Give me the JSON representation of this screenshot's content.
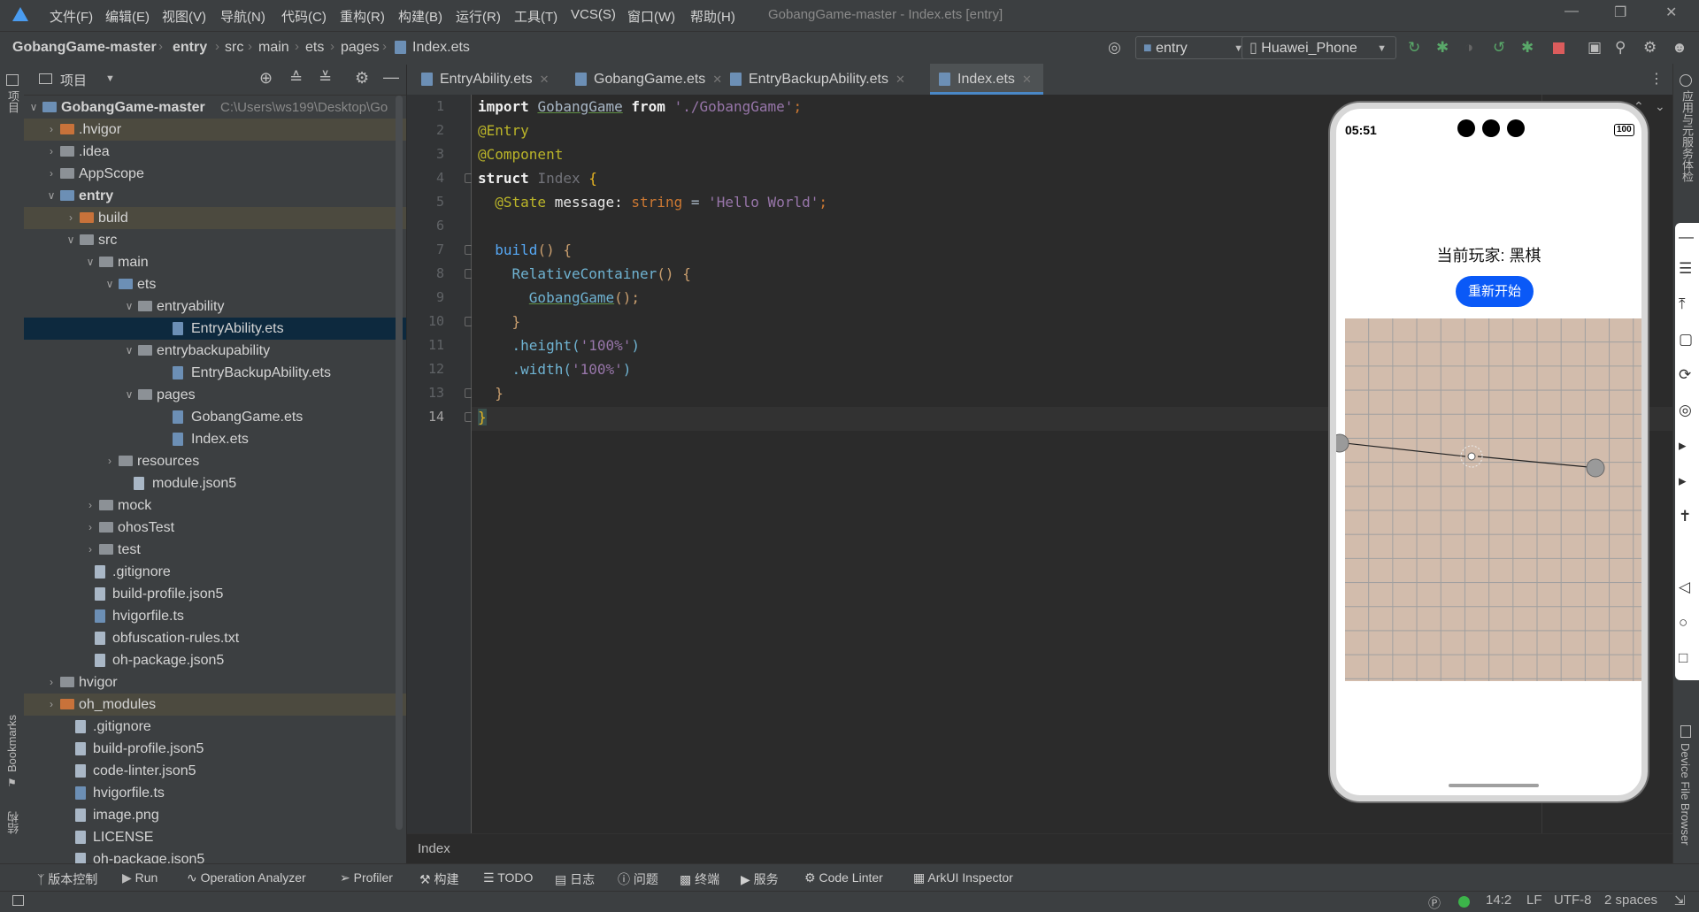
{
  "menubar": {
    "items": [
      "文件(F)",
      "编辑(E)",
      "视图(V)",
      "导航(N)",
      "代码(C)",
      "重构(R)",
      "构建(B)",
      "运行(R)",
      "工具(T)",
      "VCS(S)",
      "窗口(W)",
      "帮助(H)"
    ],
    "window_title": "GobangGame-master - Index.ets [entry]"
  },
  "navbar": {
    "breadcrumb": [
      "GobangGame-master",
      "entry",
      "src",
      "main",
      "ets",
      "pages",
      "Index.ets"
    ],
    "run_config": "entry",
    "device": "Huawei_Phone"
  },
  "left_strip": {
    "project_label": "项目",
    "bookmarks_label": "Bookmarks",
    "structure_label": "结构"
  },
  "project_panel": {
    "title": "项目",
    "rows": [
      {
        "label": "GobangGame-master",
        "path": "C:\\Users\\ws199\\Desktop\\Go"
      },
      {
        "label": ".hvigor"
      },
      {
        "label": ".idea"
      },
      {
        "label": "AppScope"
      },
      {
        "label": "entry"
      },
      {
        "label": "build"
      },
      {
        "label": "src"
      },
      {
        "label": "main"
      },
      {
        "label": "ets"
      },
      {
        "label": "entryability"
      },
      {
        "label": "EntryAbility.ets"
      },
      {
        "label": "entrybackupability"
      },
      {
        "label": "EntryBackupAbility.ets"
      },
      {
        "label": "pages"
      },
      {
        "label": "GobangGame.ets"
      },
      {
        "label": "Index.ets"
      },
      {
        "label": "resources"
      },
      {
        "label": "module.json5"
      },
      {
        "label": "mock"
      },
      {
        "label": "ohosTest"
      },
      {
        "label": "test"
      },
      {
        "label": ".gitignore"
      },
      {
        "label": "build-profile.json5"
      },
      {
        "label": "hvigorfile.ts"
      },
      {
        "label": "obfuscation-rules.txt"
      },
      {
        "label": "oh-package.json5"
      },
      {
        "label": "hvigor"
      },
      {
        "label": "oh_modules"
      },
      {
        "label": ".gitignore"
      },
      {
        "label": "build-profile.json5"
      },
      {
        "label": "code-linter.json5"
      },
      {
        "label": "hvigorfile.ts"
      },
      {
        "label": "image.png"
      },
      {
        "label": "LICENSE"
      },
      {
        "label": "oh-package.json5"
      }
    ]
  },
  "tabs": [
    "EntryAbility.ets",
    "GobangGame.ets",
    "EntryBackupAbility.ets",
    "Index.ets"
  ],
  "editor": {
    "line_numbers": [
      "1",
      "2",
      "3",
      "4",
      "5",
      "6",
      "7",
      "8",
      "9",
      "10",
      "11",
      "12",
      "13",
      "14"
    ],
    "code": {
      "l1_import": "import",
      "l1_name": "GobangGame",
      "l1_from": "from",
      "l1_path": "'./GobangGame'",
      "l1_semi": ";",
      "l2": "@Entry",
      "l3": "@Component",
      "l4_struct": "struct",
      "l4_name": "Index",
      "l4_brace": "{",
      "l5_state": "@State",
      "l5_var": "message:",
      "l5_type": "string",
      "l5_eq": "=",
      "l5_val": "'Hello World'",
      "l5_semi": ";",
      "l7_fn": "build",
      "l7_paren": "()",
      "l7_brace": "{",
      "l8_fn": "RelativeContainer",
      "l8_paren": "()",
      "l8_brace": "{",
      "l9_fn": "GobangGame",
      "l9_rest": "();",
      "l10": "}",
      "l11_dot": ".height(",
      "l11_val": "'100%'",
      "l11_close": ")",
      "l12_dot": ".width(",
      "l12_val": "'100%'",
      "l12_close": ")",
      "l13": "}",
      "l14": "}"
    },
    "bottom_crumb": "Index"
  },
  "phone": {
    "time": "05:51",
    "battery": "100",
    "current_player": "当前玩家: 黑棋",
    "restart_label": "重新开始"
  },
  "right_strip": {
    "label_top": "应用与元服务体检",
    "label_bottom": "Device File Browser"
  },
  "bottom_toolbar": [
    "版本控制",
    "Run",
    "Operation Analyzer",
    "Profiler",
    "构建",
    "TODO",
    "日志",
    "问题",
    "终端",
    "服务",
    "Code Linter",
    "ArkUI Inspector"
  ],
  "statusbar": {
    "position": "14:2",
    "line_sep": "LF",
    "encoding": "UTF-8",
    "indent": "2 spaces"
  },
  "colors": {
    "accent": "#4a88c7",
    "selection": "#0d293e",
    "phone_button": "#0a59f7",
    "board": "#d2bcac"
  }
}
